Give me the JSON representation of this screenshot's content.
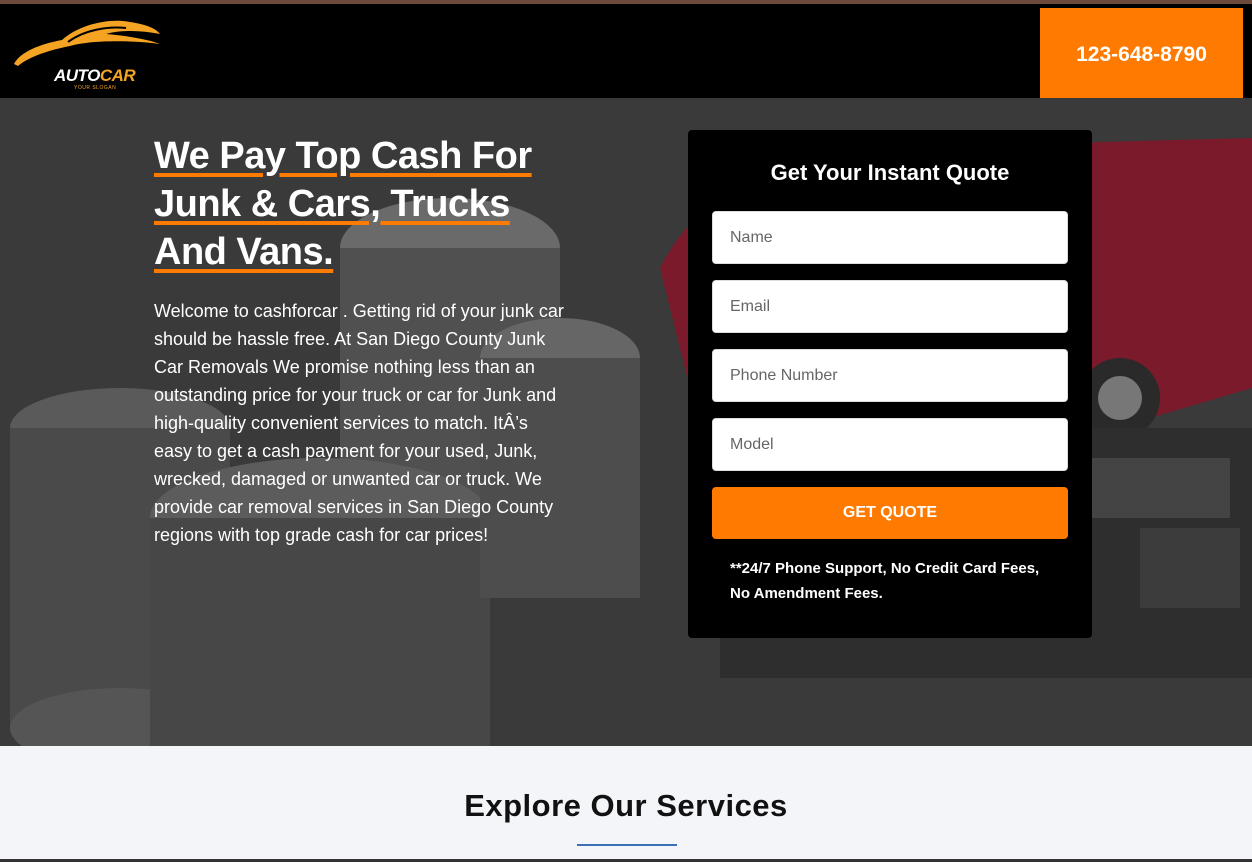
{
  "header": {
    "logo": {
      "brand_auto": "AUTO",
      "brand_car": "CAR",
      "slogan": "YOUR SLOGAN"
    },
    "phone": "123-648-8790"
  },
  "hero": {
    "headline_lines": [
      "We Pay Top Cash For",
      "Junk & Cars, Trucks",
      "And Vans."
    ],
    "intro": "Welcome to cashforcar . Getting rid of your junk car should be hassle free. At San Diego County Junk Car Removals We promise nothing less than an outstanding price for your truck or car for Junk and high-quality convenient services to match. ItÂ’s easy to get a cash payment for your used, Junk, wrecked, damaged or unwanted car or truck. We provide car removal services in San Diego County regions with top grade cash for car prices!"
  },
  "quote_form": {
    "title": "Get Your Instant Quote",
    "fields": [
      {
        "placeholder": "Name",
        "value": ""
      },
      {
        "placeholder": "Email",
        "value": ""
      },
      {
        "placeholder": "Phone Number",
        "value": ""
      },
      {
        "placeholder": "Model",
        "value": ""
      }
    ],
    "submit_label": "GET QUOTE",
    "note": "**24/7 Phone Support, No Credit Card Fees, No Amendment Fees."
  },
  "services": {
    "title": "Explore Our Services"
  },
  "colors": {
    "accent": "#ff7a00",
    "header_bg": "#000000",
    "logo_gold": "#f5a323",
    "divider": "#3b6fb6"
  }
}
